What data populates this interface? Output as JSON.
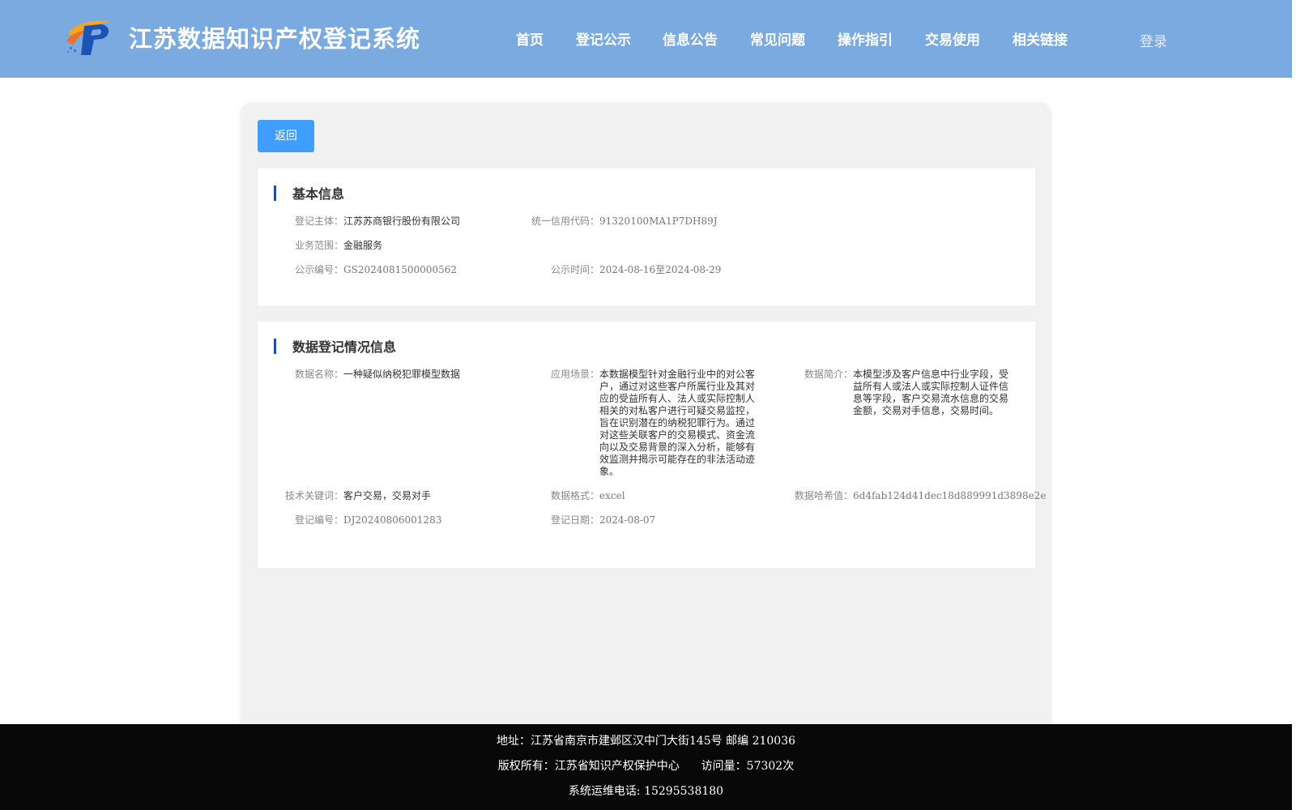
{
  "header": {
    "title": "江苏数据知识产权登记系统",
    "logo_icon": "ip-logo-icon",
    "nav": [
      {
        "label": "首页"
      },
      {
        "label": "登记公示"
      },
      {
        "label": "信息公告"
      },
      {
        "label": "常见问题"
      },
      {
        "label": "操作指引"
      },
      {
        "label": "交易使用"
      },
      {
        "label": "相关链接"
      }
    ],
    "login_label": "登录"
  },
  "back_button_label": "返回",
  "basic_info": {
    "title": "基本信息",
    "fields": {
      "subject": {
        "label": "登记主体：",
        "value": "江苏苏商银行股份有限公司"
      },
      "credit_code": {
        "label": "统一信用代码：",
        "value": "91320100MA1P7DH89J"
      },
      "scope": {
        "label": "业务范围：",
        "value": "金融服务"
      },
      "notice_no": {
        "label": "公示编号：",
        "value": "GS2024081500000562"
      },
      "notice_time": {
        "label": "公示时间：",
        "value": "2024-08-16至2024-08-29"
      }
    }
  },
  "data_info": {
    "title": "数据登记情况信息",
    "fields": {
      "data_name": {
        "label": "数据名称：",
        "value": "一种疑似纳税犯罪模型数据"
      },
      "scenario": {
        "label": "应用场景：",
        "value": "本数据模型针对金融行业中的对公客户，通过对这些客户所属行业及其对应的受益所有人、法人或实际控制人相关的对私客户进行可疑交易监控，旨在识别潜在的纳税犯罪行为。通过对这些关联客户的交易模式、资金流向以及交易背景的深入分析，能够有效监测并揭示可能存在的非法活动迹象。"
      },
      "summary": {
        "label": "数据简介：",
        "value": "本模型涉及客户信息中行业字段，受益所有人或法人或实际控制人证件信息等字段，客户交易流水信息的交易金额，交易对手信息，交易时间。"
      },
      "keywords": {
        "label": "技术关键词：",
        "value": "客户交易，交易对手"
      },
      "format": {
        "label": "数据格式：",
        "value": "excel"
      },
      "hash": {
        "label": "数据哈希值：",
        "value": "6d4fab124d41dec18d889991d3898e2e"
      },
      "reg_no": {
        "label": "登记编号：",
        "value": "DJ20240806001283"
      },
      "reg_date": {
        "label": "登记日期：",
        "value": "2024-08-07"
      }
    }
  },
  "footer": {
    "address": "地址：江苏省南京市建邺区汉中门大街145号 邮编 210036",
    "copyright": "版权所有：江苏省知识产权保护中心",
    "visits": "访问量：57302次",
    "phone": "系统运维电话: 15295538180"
  },
  "colors": {
    "header_bg": "#7aaadf",
    "button_bg": "#409eff",
    "title_bar": "#1e50a0",
    "footer_bg": "#080808"
  }
}
